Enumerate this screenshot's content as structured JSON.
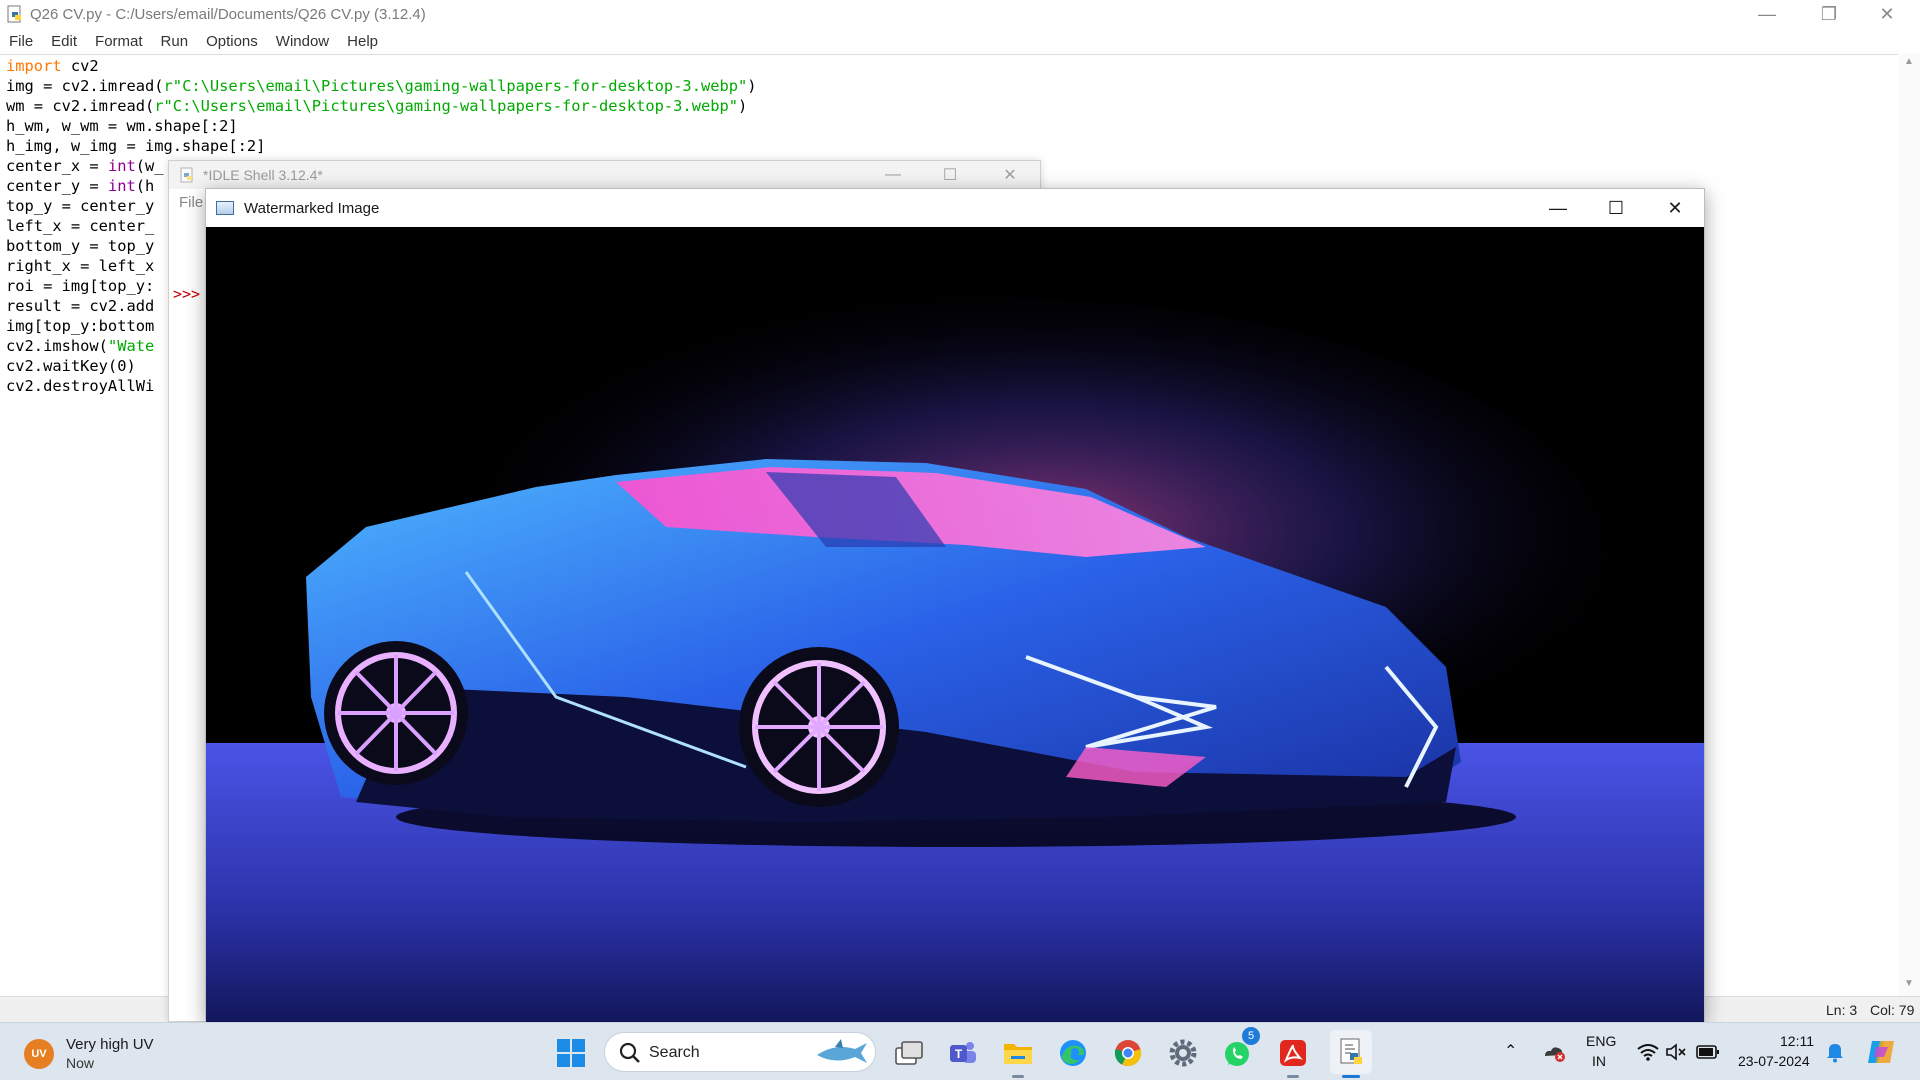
{
  "editor": {
    "title": "Q26 CV.py - C:/Users/email/Documents/Q26 CV.py (3.12.4)",
    "menu": [
      "File",
      "Edit",
      "Format",
      "Run",
      "Options",
      "Window",
      "Help"
    ],
    "code_lines": [
      "import cv2",
      "img = cv2.imread(r\"C:\\Users\\email\\Pictures\\gaming-wallpapers-for-desktop-3.webp\")",
      "wm = cv2.imread(r\"C:\\Users\\email\\Pictures\\gaming-wallpapers-for-desktop-3.webp\")",
      "h_wm, w_wm = wm.shape[:2]",
      "h_img, w_img = img.shape[:2]",
      "center_x = int(w_",
      "center_y = int(h",
      "top_y = center_y",
      "left_x = center_",
      "bottom_y = top_y",
      "right_x = left_x",
      "roi = img[top_y:",
      "result = cv2.add",
      "img[top_y:bottom",
      "cv2.imshow(\"Wate",
      "cv2.waitKey(0)",
      "cv2.destroyAllWi"
    ],
    "status": {
      "line": "Ln: 3",
      "col": "Col: 79"
    }
  },
  "shell": {
    "title": "*IDLE Shell 3.12.4*",
    "menu_first": "File",
    "prompt": ">>>"
  },
  "image_window": {
    "title": "Watermarked Image"
  },
  "taskbar": {
    "weather": {
      "badge": "UV",
      "title": "Very high UV",
      "sub": "Now"
    },
    "search_label": "Search",
    "whatsapp_badge": "5",
    "language": {
      "line1": "ENG",
      "line2": "IN"
    },
    "clock": {
      "time": "12:11",
      "date": "23-07-2024"
    }
  },
  "colors": {
    "keyword": "#ff7700",
    "builtin": "#900090",
    "string": "#00aa00",
    "prompt": "#c00000",
    "taskbar": "#dde5ef"
  }
}
